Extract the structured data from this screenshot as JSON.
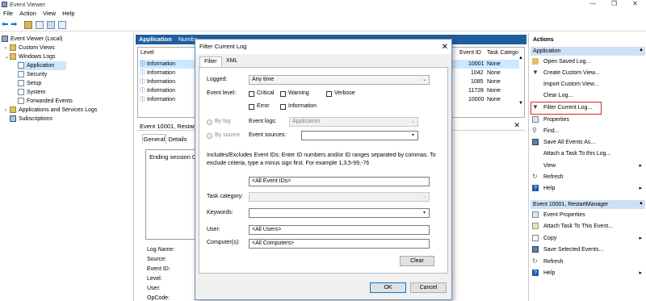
{
  "window": {
    "title": "Event Viewer"
  },
  "menu": [
    "File",
    "Action",
    "View",
    "Help"
  ],
  "tree": {
    "items": [
      {
        "label": "Event Viewer (Local)"
      },
      {
        "label": "Custom Views"
      },
      {
        "label": "Windows Logs"
      },
      {
        "label": "Application"
      },
      {
        "label": "Security"
      },
      {
        "label": "Setup"
      },
      {
        "label": "System"
      },
      {
        "label": "Forwarded Events"
      },
      {
        "label": "Applications and Services Logs"
      },
      {
        "label": "Subscriptions"
      }
    ]
  },
  "center": {
    "header": "Application",
    "header_extra": "Numbe",
    "columns": [
      "Level",
      "Event ID",
      "Task Catego"
    ],
    "rows": [
      {
        "level": "Information",
        "id": "10001",
        "task": "None"
      },
      {
        "level": "Information",
        "id": "1042",
        "task": "None"
      },
      {
        "level": "Information",
        "id": "1085",
        "task": "None"
      },
      {
        "level": "Information",
        "id": "11728",
        "task": "None"
      },
      {
        "level": "Information",
        "id": "10000",
        "task": "None"
      }
    ],
    "detail_title": "Event 10001, RestartM",
    "detail_tabs": [
      "General",
      "Details"
    ],
    "detail_text": "Ending session 0 s",
    "detail_fields": [
      "Log Name:",
      "Source:",
      "Event ID:",
      "Level:",
      "User:",
      "OpCode:"
    ]
  },
  "actions": {
    "header": "Actions",
    "section1": "Application",
    "items1": [
      "Open Saved Log...",
      "Create Custom View...",
      "Import Custom View...",
      "Clear Log...",
      "Filter Current Log...",
      "Properties",
      "Find...",
      "Save All Events As...",
      "Attach a Task To this Log...",
      "View",
      "Refresh",
      "Help"
    ],
    "section2": "Event 10001, RestartManager",
    "items2": [
      "Event Properties",
      "Attach Task To This Event...",
      "Copy",
      "Save Selected Events...",
      "Refresh",
      "Help"
    ]
  },
  "dialog": {
    "title": "Filter Current Log",
    "tabs": [
      "Filter",
      "XML"
    ],
    "logged_label": "Logged:",
    "logged_value": "Any time",
    "event_level_label": "Event level:",
    "levels": [
      "Critical",
      "Warning",
      "Verbose",
      "Error",
      "Information"
    ],
    "by_log": "By log",
    "by_source": "By source",
    "event_logs_label": "Event logs:",
    "event_logs_value": "Application",
    "event_sources_label": "Event sources:",
    "help_text": "Includes/Excludes Event IDs: Enter ID numbers and/or ID ranges separated by commas. To exclude criteria, type a minus sign first. For example 1,3,5-99,-76",
    "event_ids_value": "<All Event IDs>",
    "task_category_label": "Task category:",
    "keywords_label": "Keywords:",
    "user_label": "User:",
    "user_value": "<All Users>",
    "computer_label": "Computer(s):",
    "computer_value": "<All Computers>",
    "clear_btn": "Clear",
    "ok_btn": "OK",
    "cancel_btn": "Cancel"
  },
  "colors": {
    "highlight": "#cde8ff",
    "header_blue": "#1f5f9e",
    "annotation_red": "#e02020"
  }
}
